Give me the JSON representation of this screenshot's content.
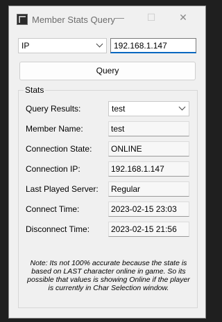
{
  "window": {
    "title": "Member Stats Query"
  },
  "controls": {
    "caption_min": "—",
    "caption_max": "☐",
    "caption_close": "✕"
  },
  "search": {
    "type_selected": "IP",
    "input_value": "192.168.1.147"
  },
  "query_button": "Query",
  "stats": {
    "group_title": "Stats",
    "rows": [
      {
        "label": "Query Results:",
        "value": "test"
      },
      {
        "label": "Member Name:",
        "value": "test"
      },
      {
        "label": "Connection State:",
        "value": "ONLINE"
      },
      {
        "label": "Connection IP:",
        "value": "192.168.1.147"
      },
      {
        "label": "Last Played Server:",
        "value": "Regular"
      },
      {
        "label": "Connect Time:",
        "value": "2023-02-15 23:03"
      },
      {
        "label": "Disconnect Time:",
        "value": "2023-02-15 21:56"
      }
    ]
  },
  "note": "Note: Its not 100% accurate because the state is based on LAST character online in game. So its possible that values is showing Online if the player is currently in Char Selection window.",
  "colors": {
    "accent": "#0067c0",
    "window_bg": "#f0f0f0",
    "desktop_bg": "#1f1f1f"
  }
}
